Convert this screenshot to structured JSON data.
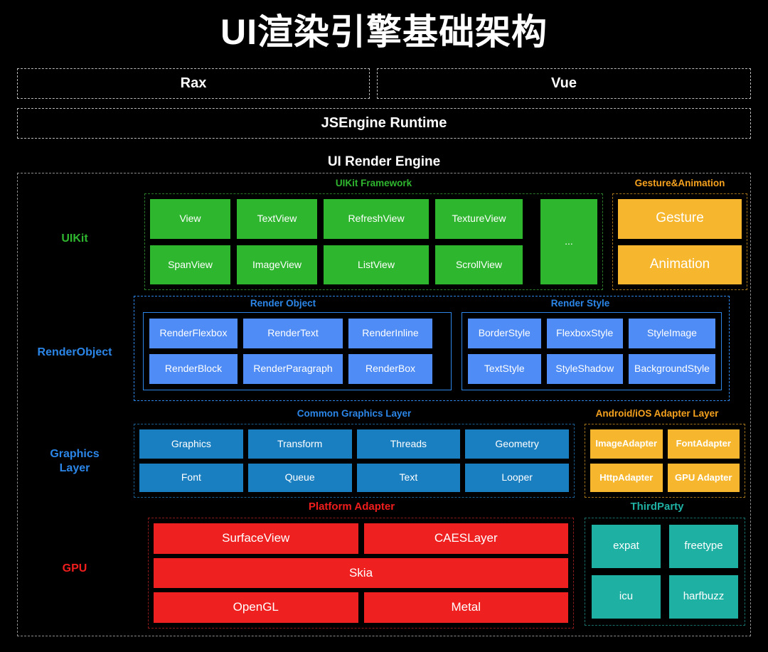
{
  "title": "UI渲染引擎基础架构",
  "top_layers": [
    {
      "id": "rax",
      "label": "Rax"
    },
    {
      "id": "vue",
      "label": "Vue"
    },
    {
      "id": "jsengine",
      "label": "JSEngine Runtime"
    }
  ],
  "engine": {
    "heading": "UI Render Engine",
    "rows": [
      {
        "id": "uikit",
        "label": "UIKit",
        "label_color": "#2fb62f",
        "groups": [
          {
            "id": "uikit-framework",
            "caption": "UIKit Framework",
            "caption_color": "#2fb62f",
            "border_color": "#2a7a2a",
            "box_color": "#2fb62f",
            "items": [
              "View",
              "TextView",
              "RefreshView",
              "TextureView",
              "...",
              "SpanView",
              "ImageView",
              "ListView",
              "ScrollView"
            ]
          },
          {
            "id": "gesture-animation",
            "caption": "Gesture&Animation",
            "caption_color": "#f6a21e",
            "border_color": "#a0721a",
            "box_color": "#f6b72f",
            "items": [
              "Gesture",
              "Animation"
            ]
          }
        ]
      },
      {
        "id": "renderobject",
        "label": "RenderObject",
        "label_color": "#2b86e8",
        "groups": [
          {
            "id": "render-object",
            "caption": "Render Object",
            "caption_color": "#2b86e8",
            "border_color": "#2b86e8",
            "box_color": "#4f8cf5",
            "items": [
              "RenderFlexbox",
              "RenderText",
              "RenderInline",
              "RenderBlock",
              "RenderParagraph",
              "RenderBox"
            ]
          },
          {
            "id": "render-style",
            "caption": "Render Style",
            "caption_color": "#2b86e8",
            "border_color": "#2b86e8",
            "box_color": "#4f8cf5",
            "items": [
              "BorderStyle",
              "FlexboxStyle",
              "StyleImage",
              "TextStyle",
              "StyleShadow",
              "BackgroundStyle"
            ]
          }
        ]
      },
      {
        "id": "graphics",
        "label": "Graphics\nLayer",
        "label_line1": "Graphics",
        "label_line2": "Layer",
        "label_color": "#2b86e8",
        "groups": [
          {
            "id": "common-graphics-layer",
            "caption": "Common Graphics Layer",
            "caption_color": "#2b86e8",
            "border_color": "#1a5f91",
            "box_color": "#1a7fc1",
            "items": [
              "Graphics",
              "Transform",
              "Threads",
              "Geometry",
              "Font",
              "Queue",
              "Text",
              "Looper"
            ]
          },
          {
            "id": "adapter-layer",
            "caption": "Android/iOS Adapter Layer",
            "caption_color": "#f6a21e",
            "border_color": "#a0721a",
            "box_color": "#f6b72f",
            "items": [
              "ImageAdapter",
              "FontAdapter",
              "HttpAdapter",
              "GPU Adapter"
            ]
          }
        ]
      },
      {
        "id": "gpu",
        "label": "GPU",
        "label_color": "#f01d1d",
        "groups": [
          {
            "id": "platform-adapter",
            "caption": "Platform Adapter",
            "caption_color": "#f01d1d",
            "border_color": "#8b1a1a",
            "box_color": "#ef2020",
            "items": [
              "SurfaceView",
              "CAESLayer",
              "Skia",
              "OpenGL",
              "Metal"
            ]
          },
          {
            "id": "thirdparty",
            "caption": "ThirdParty",
            "caption_color": "#1fb0a4",
            "border_color": "#166f68",
            "box_color": "#1fb0a4",
            "items": [
              "expat",
              "freetype",
              "icu",
              "harfbuzz"
            ]
          }
        ]
      }
    ]
  }
}
